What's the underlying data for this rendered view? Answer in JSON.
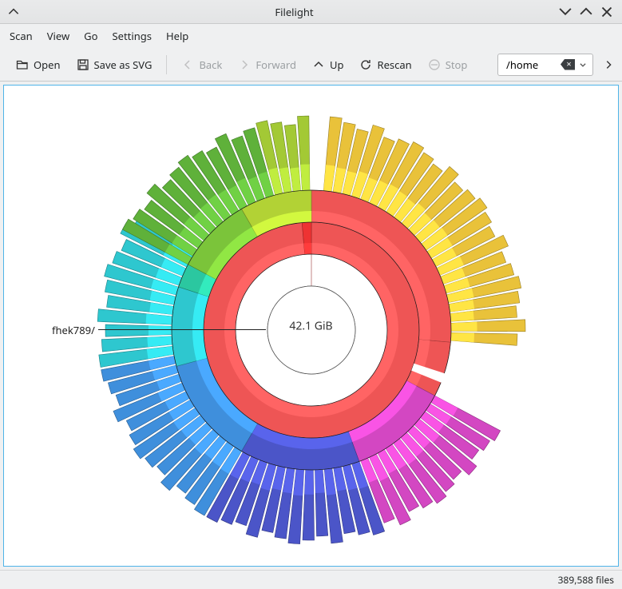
{
  "window": {
    "title": "Filelight"
  },
  "menu": {
    "scan": "Scan",
    "view": "View",
    "go": "Go",
    "settings": "Settings",
    "help": "Help"
  },
  "toolbar": {
    "open": "Open",
    "save_svg": "Save as SVG",
    "back": "Back",
    "forward": "Forward",
    "up": "Up",
    "rescan": "Rescan",
    "stop": "Stop"
  },
  "path": {
    "value": "/home"
  },
  "chart": {
    "center_size": "42.1 GiB",
    "dir_label": "fhek789/"
  },
  "status": {
    "files_text": "389,588 files"
  },
  "chart_data": {
    "type": "sunburst",
    "center": {
      "label": "42.1 GiB",
      "path": "/home"
    },
    "labeled_dir": "fhek789/",
    "note": "angles are approximate degrees clockwise from 12 o'clock; inner rings are nearly fully red (single large subtree)",
    "ring1": [
      {
        "start": 0,
        "end": 360,
        "color": "#e55"
      }
    ],
    "ring2": [
      {
        "start": 0,
        "end": 355,
        "color": "#e55"
      },
      {
        "start": 355,
        "end": 360,
        "color": "#e33"
      }
    ],
    "ring3": [
      {
        "start": 0,
        "end": 95,
        "color": "#e55"
      },
      {
        "start": 95,
        "end": 110,
        "color": "#e55"
      },
      {
        "start": 110,
        "end": 118,
        "color": "#e55"
      },
      {
        "start": 118,
        "end": 160,
        "color": "#d347c2"
      },
      {
        "start": 160,
        "end": 210,
        "color": "#4b55c8"
      },
      {
        "start": 210,
        "end": 255,
        "color": "#3f8fdc"
      },
      {
        "start": 255,
        "end": 288,
        "color": "#2ec7cf"
      },
      {
        "start": 288,
        "end": 298,
        "color": "#2bc7a0"
      },
      {
        "start": 298,
        "end": 330,
        "color": "#7bc43a"
      },
      {
        "start": 330,
        "end": 360,
        "color": "#b2d235"
      }
    ],
    "ring4": [
      {
        "start": 5,
        "end": 95,
        "color": "#e9c23a",
        "fragmented": true
      },
      {
        "start": 118,
        "end": 160,
        "color": "#d347c2",
        "fragmented": true
      },
      {
        "start": 160,
        "end": 210,
        "color": "#4b55c8",
        "fragmented": true
      },
      {
        "start": 210,
        "end": 260,
        "color": "#3f8fdc",
        "fragmented": true
      },
      {
        "start": 260,
        "end": 305,
        "color": "#2ec7cf",
        "fragmented": true
      },
      {
        "start": 298,
        "end": 345,
        "color": "#5fb13a",
        "fragmented": true
      },
      {
        "start": 345,
        "end": 360,
        "color": "#a3c935",
        "fragmented": true
      }
    ]
  }
}
